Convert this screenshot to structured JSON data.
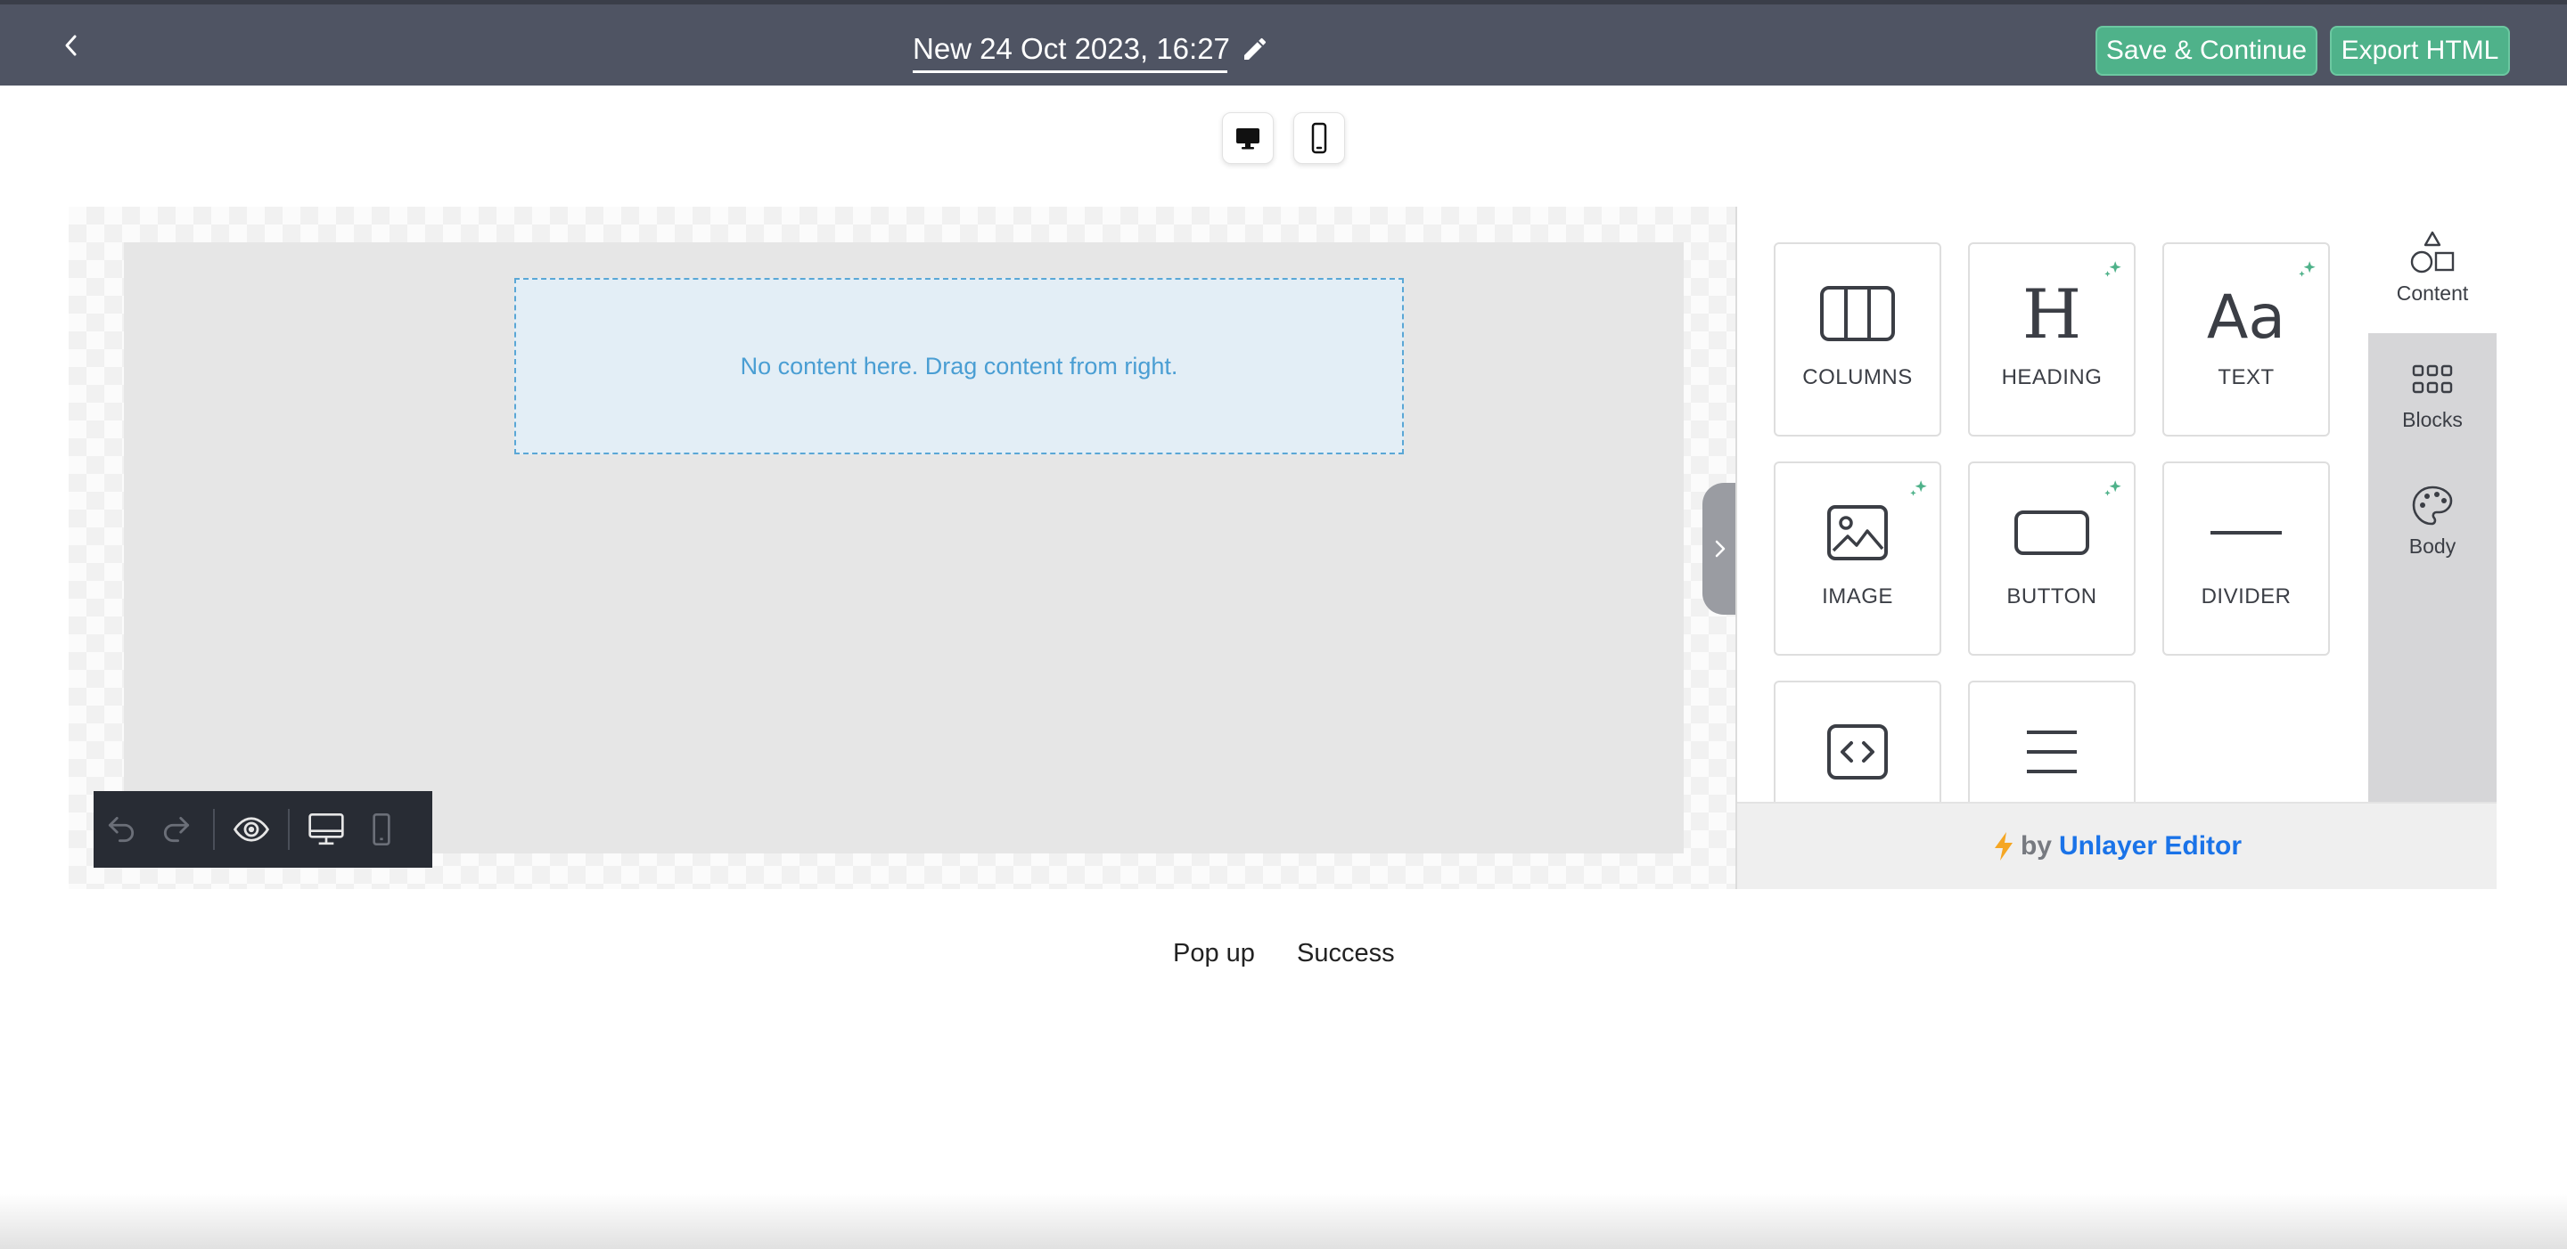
{
  "header": {
    "title": "New 24 Oct 2023, 16:27",
    "save_label": "Save & Continue",
    "export_label": "Export HTML",
    "accent_color": "#4fb28a",
    "bar_color": "#4f5463"
  },
  "canvas": {
    "empty_message": "No content here. Drag content from right."
  },
  "tools": {
    "items": [
      {
        "label": "COLUMNS",
        "icon": "columns-icon",
        "sparkle": false
      },
      {
        "label": "HEADING",
        "icon": "heading-icon",
        "sparkle": true
      },
      {
        "label": "TEXT",
        "icon": "text-icon",
        "sparkle": true
      },
      {
        "label": "IMAGE",
        "icon": "image-icon",
        "sparkle": true
      },
      {
        "label": "BUTTON",
        "icon": "button-icon",
        "sparkle": true
      },
      {
        "label": "DIVIDER",
        "icon": "divider-icon",
        "sparkle": false
      },
      {
        "label": "",
        "icon": "html-icon",
        "sparkle": false
      },
      {
        "label": "",
        "icon": "menu-icon",
        "sparkle": false
      }
    ]
  },
  "side_tabs": [
    {
      "label": "Content",
      "icon": "shapes-icon",
      "active": true
    },
    {
      "label": "Blocks",
      "icon": "grid-icon",
      "active": false
    },
    {
      "label": "Body",
      "icon": "palette-icon",
      "active": false
    }
  ],
  "footer": {
    "by": "by",
    "brand": "Unlayer Editor",
    "brand_color": "#1a73e8"
  },
  "pages": [
    "Pop up",
    "Success"
  ]
}
